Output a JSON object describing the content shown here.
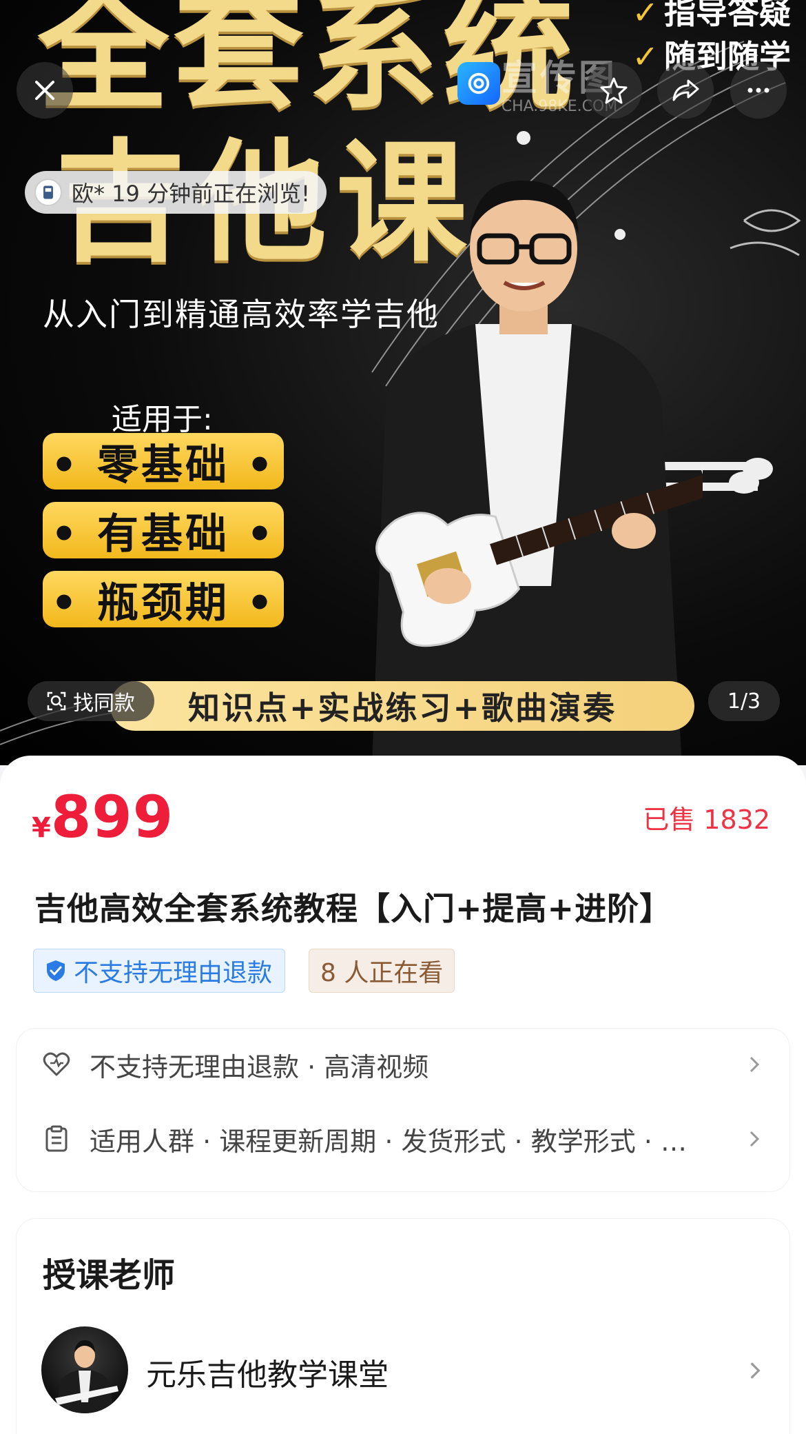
{
  "hero": {
    "title_line1": "全套系统",
    "title_line2": "吉他课",
    "subtitle": "从入门到精通高效率学吉他",
    "applies_label": "适用于:",
    "pills": [
      "• 零基础 •",
      "• 有基础 •",
      "• 瓶颈期 •"
    ],
    "right_checks": [
      "指导答疑",
      "随到随学"
    ],
    "banner": "知识点+实战练习+歌曲演奏",
    "toast_text": "欧* 19 分钟前正在浏览!",
    "find_same_label": "找同款",
    "pager": "1/3",
    "watermark_title": "宣传图",
    "watermark_url": "CHA.98KE.COM"
  },
  "product": {
    "currency": "¥",
    "price": "899",
    "sold": "已售 1832",
    "title": "吉他高效全套系统教程【入门+提高+进阶】",
    "tag_refund": "不支持无理由退款",
    "tag_viewers": "8 人正在看"
  },
  "info_card": {
    "row1": "不支持无理由退款 · 高清视频",
    "row2": "适用人群 · 课程更新周期 · 发货形式 · 教学形式 · …"
  },
  "teacher": {
    "heading": "授课老师",
    "name": "元乐吉他教学课堂"
  },
  "icons": {
    "close": "close-icon",
    "star": "star-icon",
    "share": "share-icon",
    "more": "more-icon",
    "scan": "scan-icon",
    "shield": "shield-check-icon",
    "heart": "heart-icon",
    "clipboard": "clipboard-icon",
    "chevron": "chevron-right-icon"
  },
  "colors": {
    "price_red": "#ee1d3a",
    "gold": "#f3d98a",
    "pill_yellow": "#f2b81c",
    "tag_blue": "#2a7be4",
    "tag_brown": "#8a5a34"
  }
}
